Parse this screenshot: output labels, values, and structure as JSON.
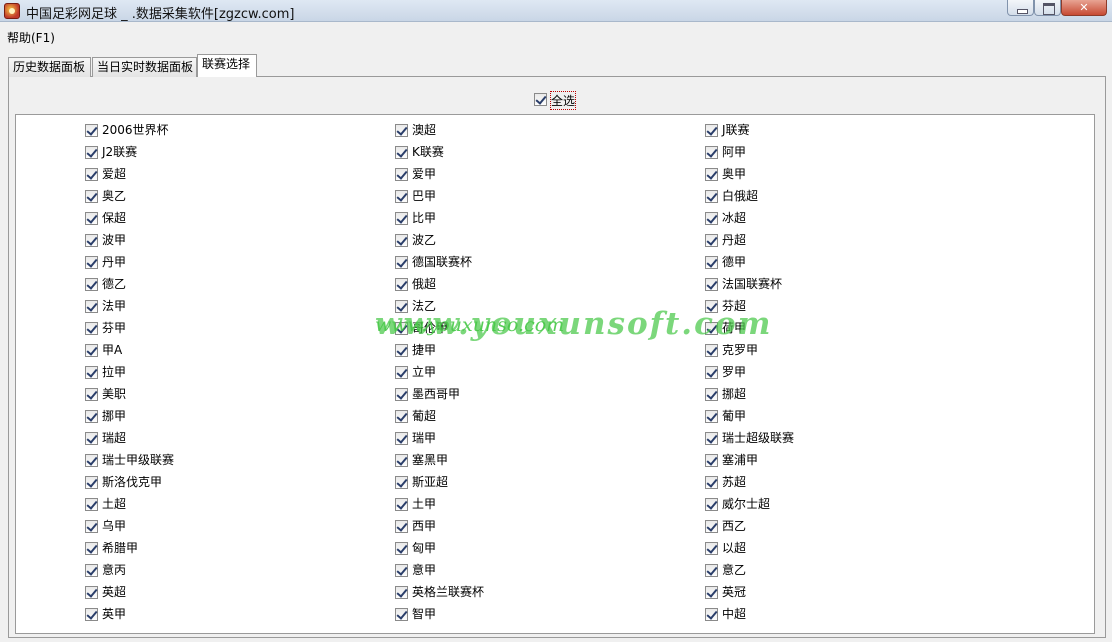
{
  "window": {
    "title": "中国足彩网足球  _ .数据采集软件[zgzcw.com]"
  },
  "menu": {
    "help": "帮助(F1)"
  },
  "tabs": [
    "历史数据面板",
    "当日实时数据面板",
    "联赛选择"
  ],
  "select_all": {
    "label": "全选",
    "checked": true
  },
  "watermark": {
    "large": "www.youxunsoft.com",
    "small": "www.youxunso.com"
  },
  "leagues": [
    [
      "2006世界杯",
      "澳超",
      "J联赛"
    ],
    [
      "J2联赛",
      "K联赛",
      "阿甲"
    ],
    [
      "爱超",
      "爱甲",
      "奥甲"
    ],
    [
      "奥乙",
      "巴甲",
      "白俄超"
    ],
    [
      "保超",
      "比甲",
      "冰超"
    ],
    [
      "波甲",
      "波乙",
      "丹超"
    ],
    [
      "丹甲",
      "德国联赛杯",
      "德甲"
    ],
    [
      "德乙",
      "俄超",
      "法国联赛杯"
    ],
    [
      "法甲",
      "法乙",
      "芬超"
    ],
    [
      "芬甲",
      "哥伦甲",
      "荷甲"
    ],
    [
      "甲A",
      "捷甲",
      "克罗甲"
    ],
    [
      "拉甲",
      "立甲",
      "罗甲"
    ],
    [
      "美职",
      "墨西哥甲",
      "挪超"
    ],
    [
      "挪甲",
      "葡超",
      "葡甲"
    ],
    [
      "瑞超",
      "瑞甲",
      "瑞士超级联赛"
    ],
    [
      "瑞士甲级联赛",
      "塞黑甲",
      "塞浦甲"
    ],
    [
      "斯洛伐克甲",
      "斯亚超",
      "苏超"
    ],
    [
      "土超",
      "土甲",
      "威尔士超"
    ],
    [
      "乌甲",
      "西甲",
      "西乙"
    ],
    [
      "希腊甲",
      "匈甲",
      "以超"
    ],
    [
      "意丙",
      "意甲",
      "意乙"
    ],
    [
      "英超",
      "英格兰联赛杯",
      "英冠"
    ],
    [
      "英甲",
      "智甲",
      "中超"
    ]
  ]
}
